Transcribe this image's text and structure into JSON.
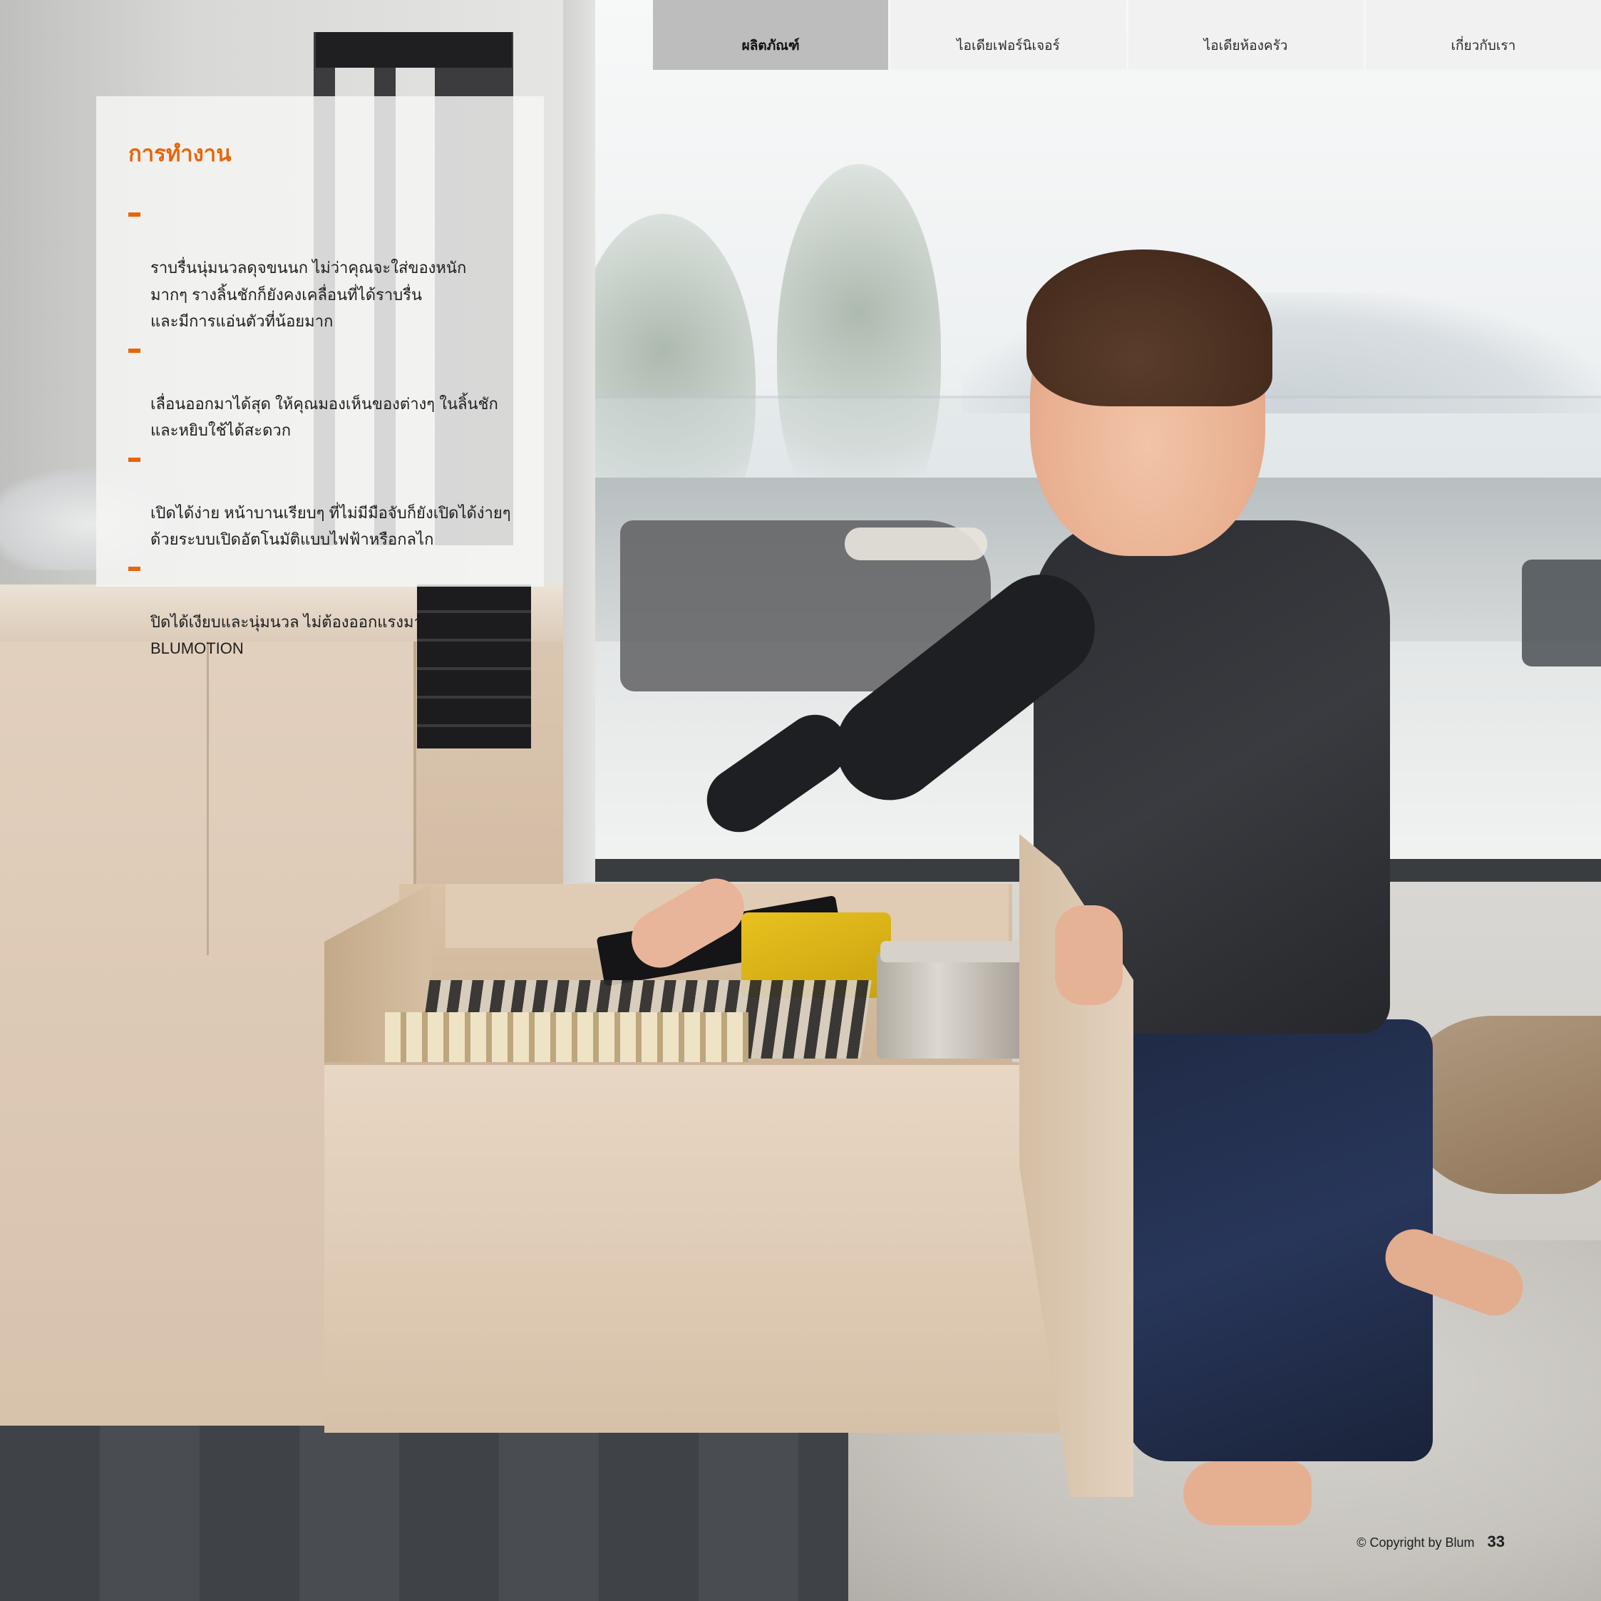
{
  "nav": {
    "tabs": [
      {
        "label": "ผลิตภัณฑ์",
        "active": true
      },
      {
        "label": "ไอเดียเฟอร์นิเจอร์",
        "active": false
      },
      {
        "label": "ไอเดียห้องครัว",
        "active": false
      },
      {
        "label": "เกี่ยวกับเรา",
        "active": false
      }
    ]
  },
  "panel": {
    "title": "การทำงาน",
    "bullets": [
      "ราบรื่นนุ่มนวลดุจขนนก ไม่ว่าคุณจะใส่ของหนัก\nมากๆ รางลิ้นชักก็ยังคงเคลื่อนที่ได้ราบรื่น\nและมีการแอ่นตัวที่น้อยมาก",
      "เลื่อนออกมาได้สุด ให้คุณมองเห็นของต่างๆ ในลิ้นชัก\nและหยิบใช้ได้สะดวก",
      "เปิดได้ง่าย หน้าบานเรียบๆ ที่ไม่มีมือจับก็ยังเปิดได้ง่ายๆ\nด้วยระบบเปิดอัตโนมัติแบบไฟฟ้าหรือกลไก",
      "ปิดได้เงียบและนุ่มนวล ไม่ต้องออกแรงมาก ด้วย\nBLUMOTION"
    ]
  },
  "footer": {
    "copyright": "© Copyright by Blum",
    "page_number": "33"
  },
  "colors": {
    "accent": "#e8640a",
    "nav_active": "#bdbdbd",
    "nav_inactive": "#f1f1f1"
  }
}
